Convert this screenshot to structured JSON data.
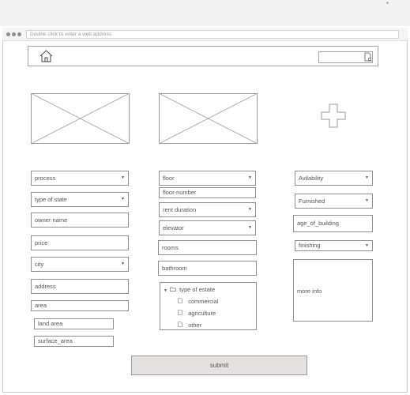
{
  "browser": {
    "address_placeholder": "Double click to enter a web address",
    "top_right_mark": "*"
  },
  "header": {
    "home_icon": "home-icon",
    "search_icon": "search-icon"
  },
  "images": {
    "placeholder_icon": "image-placeholder",
    "add_icon": "plus-icon"
  },
  "form": {
    "col1": {
      "process": "process",
      "type_of_state": "type of state",
      "owner_name": "owner name",
      "price": "price",
      "city": "city",
      "address": "address",
      "area": "area",
      "land_area": "land area",
      "surface_area": "surface_area"
    },
    "col2": {
      "floor": "floor",
      "floor_number": "floor-number",
      "rent_duration": "rent duration",
      "elevator": "elevator",
      "rooms": "rooms",
      "bathroom": "bathroom",
      "tree": {
        "root": "type of estate",
        "items": [
          "commercial",
          "agriculture",
          "other"
        ]
      }
    },
    "col3": {
      "availability": "Avilability",
      "furnished": "Furnished",
      "age_of_building": "age_of_building",
      "finishing": "finishing",
      "more_info": "more info"
    },
    "submit": "submit"
  }
}
